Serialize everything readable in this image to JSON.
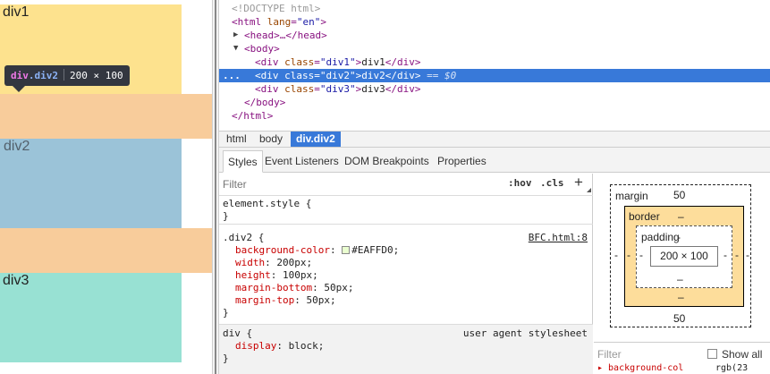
{
  "page": {
    "div1": "div1",
    "div2": "div2",
    "div3": "div3",
    "colors": {
      "div1": "#fde28e",
      "div2": "#9bc3d8",
      "div3": "#98e1d3",
      "margin": "#f8cc9b"
    }
  },
  "tooltip": {
    "tag": "div",
    "cls": ".div2",
    "size": "200 × 100"
  },
  "dom": {
    "doctype": "<!DOCTYPE html>",
    "html_open": "<html",
    "html_attr": "lang",
    "html_val": "\"en\"",
    "head": "<head>…</head>",
    "body_open": "<body>",
    "div_open": "<div",
    "class_attr": "class",
    "div_close": "</div>",
    "div1_class": "\"div1\"",
    "div1_text": "div1",
    "div2_class": "\"div2\"",
    "div2_text": "div2",
    "div3_class": "\"div3\"",
    "div3_text": "div3",
    "selected_marker": "== $0",
    "ellipsis": "...",
    "body_close": "</body>",
    "html_close": "</html>"
  },
  "breadcrumbs": [
    "html",
    "body",
    "div.div2"
  ],
  "tabs": [
    "Styles",
    "Event Listeners",
    "DOM Breakpoints",
    "Properties"
  ],
  "styles": {
    "filter_placeholder": "Filter",
    "hov": ":hov",
    "cls": ".cls",
    "add": "+",
    "element_style": "element.style {",
    "close_brace": "}",
    "div2_selector": ".div2 {",
    "div2_source": "BFC.html:8",
    "declarations": [
      {
        "prop": "background-color",
        "value": "#EAFFD0;",
        "swatch": "#EAFFD0"
      },
      {
        "prop": "width",
        "value": "200px;"
      },
      {
        "prop": "height",
        "value": "100px;"
      },
      {
        "prop": "margin-bottom",
        "value": "50px;"
      },
      {
        "prop": "margin-top",
        "value": "50px;"
      }
    ],
    "ua_selector": "div {",
    "ua_source": "user agent stylesheet",
    "ua_prop": "display",
    "ua_value": "block;"
  },
  "box_model": {
    "margin_label": "margin",
    "margin_top": "50",
    "margin_bottom": "50",
    "margin_left": "-",
    "margin_right": "-",
    "border_label": "border",
    "border_top": "–",
    "border_bottom": "–",
    "border_left": "-",
    "border_right": "-",
    "padding_label": "padding",
    "padding_top": "-",
    "padding_bottom": "–",
    "padding_left": "-",
    "padding_right": "-",
    "content": "200 × 100",
    "filter_placeholder": "Filter",
    "show_all": "Show all",
    "computed_partial": "▸ background-col",
    "computed_value": "rgb(23"
  }
}
